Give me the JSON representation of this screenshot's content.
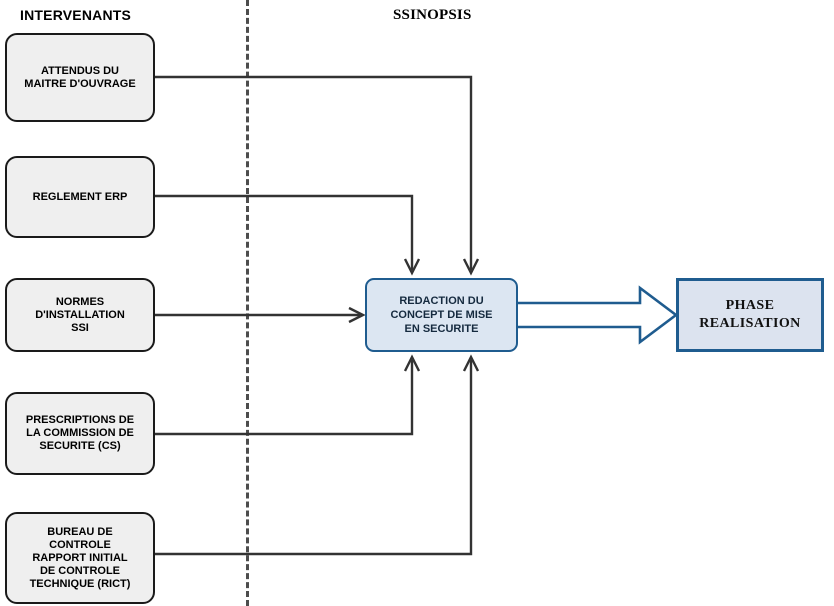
{
  "headings": {
    "left_column": "INTERVENANTS",
    "right_column": "SSINOPSIS"
  },
  "colors": {
    "input_box_fill": "#efefef",
    "input_box_border": "#1a1a1a",
    "process_box_fill": "#dce6f2",
    "process_box_border": "#1f5c8f",
    "output_box_fill": "#dce3ef",
    "output_box_border": "#1f5c8f",
    "connector": "#333333",
    "divider": "#4d4d4d",
    "block_arrow_stroke": "#1f5c8f",
    "block_arrow_fill": "#ffffff"
  },
  "inputs": [
    {
      "id": "attendus",
      "label": "ATTENDUS DU\nMAITRE D'OUVRAGE"
    },
    {
      "id": "reglement",
      "label": "REGLEMENT ERP"
    },
    {
      "id": "normes",
      "label": "NORMES\nD'INSTALLATION\nSSI"
    },
    {
      "id": "prescriptions",
      "label": "PRESCRIPTIONS DE\nLA COMMISSION DE\nSECURITE (CS)"
    },
    {
      "id": "bureau",
      "label": "BUREAU DE\nCONTROLE\nRAPPORT INITIAL\nDE CONTROLE\nTECHNIQUE (RICT)"
    }
  ],
  "process": {
    "id": "redaction",
    "label": "REDACTION DU\nCONCEPT DE MISE\nEN SECURITE"
  },
  "output": {
    "id": "phase-realisation",
    "label": "PHASE\nREALISATION"
  },
  "connectors": [
    {
      "from": "attendus",
      "to": "redaction",
      "style": "elbow-down",
      "arrowhead": "open-v"
    },
    {
      "from": "reglement",
      "to": "redaction",
      "style": "elbow-down",
      "arrowhead": "open-v"
    },
    {
      "from": "normes",
      "to": "redaction",
      "style": "straight",
      "arrowhead": "open-v"
    },
    {
      "from": "prescriptions",
      "to": "redaction",
      "style": "elbow-up",
      "arrowhead": "open-v"
    },
    {
      "from": "bureau",
      "to": "redaction",
      "style": "elbow-up",
      "arrowhead": "open-v"
    },
    {
      "from": "redaction",
      "to": "phase-realisation",
      "style": "block-arrow",
      "arrowhead": "solid-block"
    }
  ]
}
